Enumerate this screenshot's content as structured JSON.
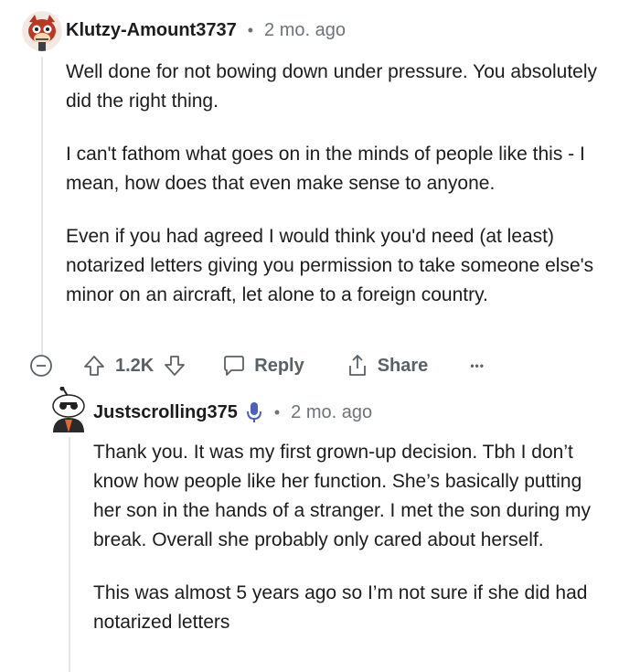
{
  "comment1": {
    "username": "Klutzy-Amount3737",
    "separator": "•",
    "time": "2 mo. ago",
    "paragraphs": [
      "Well done for not bowing down under pressure. You absolutely did the right thing.",
      "I can't fathom what goes on in the minds of people like this - I mean, how does that even make sense to anyone.",
      "Even if you had agreed I would think you'd need (at least) notarized letters giving you permission to take someone else's minor on an aircraft, let alone to a foreign country."
    ],
    "actions": {
      "vote_count": "1.2K",
      "reply_label": "Reply",
      "share_label": "Share",
      "more_label": "•••"
    }
  },
  "comment2": {
    "username": "Justscrolling375",
    "separator": "•",
    "time": "2 mo. ago",
    "paragraphs": [
      "Thank you. It was my first grown-up decision. Tbh I don’t know how people like her function. She’s basically putting her son in the hands of a stranger. I met the son during my break. Overall she probably only cared about herself.",
      "This was almost 5 years ago so I’m not sure if she did had notarized letters"
    ]
  },
  "colors": {
    "muted": "#6d7378",
    "action": "#5a6166",
    "thread_line": "#e3e5e8",
    "mic_badge": "#4a5fc1"
  }
}
